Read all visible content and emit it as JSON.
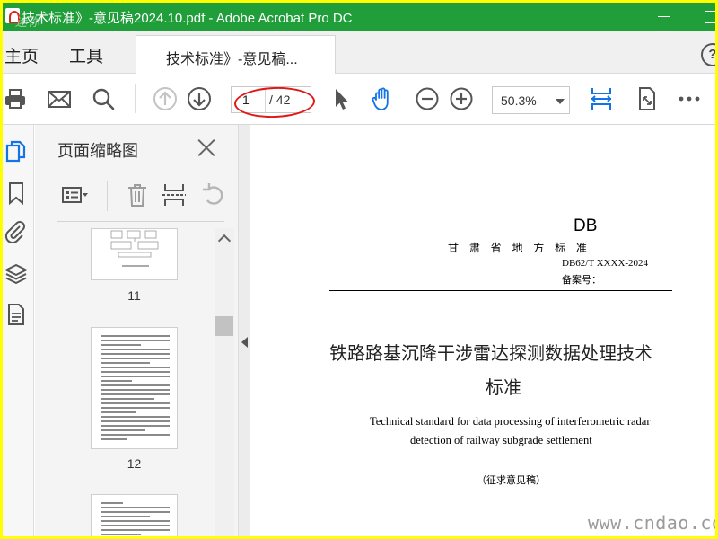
{
  "window": {
    "title": "技术标准》-意见稿2024.10.pdf - Adobe Acrobat Pro DC",
    "title_watermark": "迷你"
  },
  "nav": {
    "home": "主页",
    "tools": "工具"
  },
  "doc_tab": {
    "label": "技术标准》-意见稿..."
  },
  "toolbar": {
    "page_current": "1",
    "page_total": "/ 42",
    "zoom": "50.3%"
  },
  "help": {
    "label": "?"
  },
  "panel": {
    "title": "页面缩略图",
    "thumbnails": [
      {
        "page": "11"
      },
      {
        "page": "12"
      }
    ]
  },
  "document": {
    "db": "DB",
    "province": "甘 肃 省 地 方 标 准",
    "code": "DB62/T XXXX-2024",
    "filing": "备案号：",
    "title_cn_line1": "铁路路基沉降干涉雷达探测数据处理技术",
    "title_cn_line2": "标准",
    "title_en_line1": "Technical standard for data processing of interferometric radar",
    "title_en_line2": "detection of railway subgrade settlement",
    "status": "（征求意见稿）"
  },
  "watermark": "www.cndao.com",
  "colors": {
    "titlebar": "#1f9e3a",
    "frame": "#ffff00",
    "accent": "#1473e6",
    "annotation": "#e01818"
  }
}
